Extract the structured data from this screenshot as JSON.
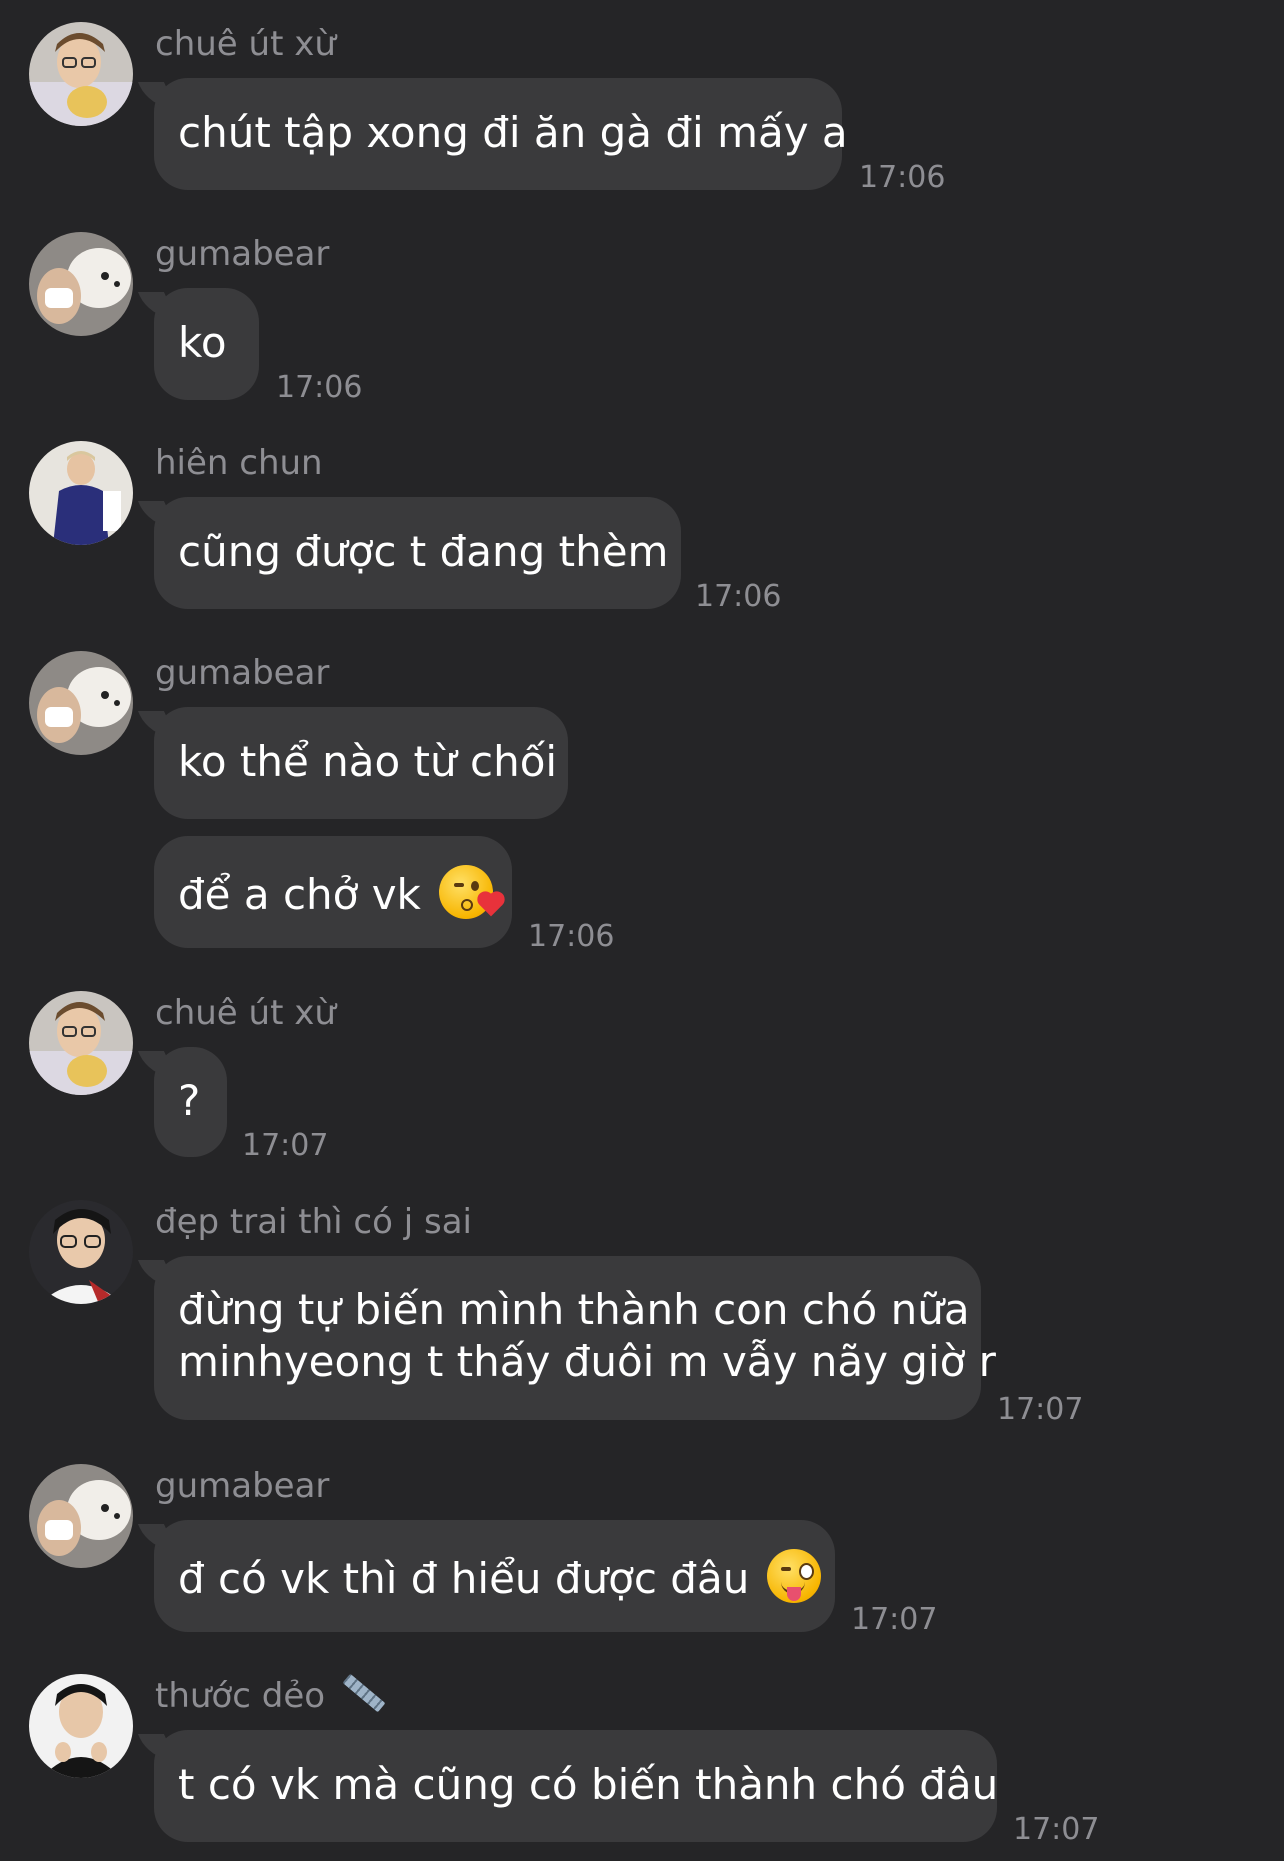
{
  "messages": [
    {
      "sender": "chuê út xừ",
      "lines": [
        "chút tập xong đi ăn gà đi mấy a"
      ],
      "time": "17:06",
      "avatar": "avatar-blonde-glasses"
    },
    {
      "sender": "gumabear",
      "lines": [
        "ko"
      ],
      "time": "17:06",
      "avatar": "avatar-dog-selfie"
    },
    {
      "sender": "hiên chun",
      "lines": [
        "cũng được t đang thèm"
      ],
      "time": "17:06",
      "avatar": "avatar-blue-hoodie"
    },
    {
      "sender": "gumabear",
      "lines": [
        "ko thể nào từ chối"
      ],
      "avatar": "avatar-dog-selfie"
    },
    {
      "lines": [
        "để a chở vk"
      ],
      "emoji": "face-blowing-kiss-icon",
      "time": "17:06"
    },
    {
      "sender": "chuê út xừ",
      "lines": [
        "?"
      ],
      "time": "17:07",
      "avatar": "avatar-blonde-glasses"
    },
    {
      "sender": "đẹp trai thì có j sai",
      "lines": [
        "đừng tự biến mình thành con chó nữa",
        "minhyeong t thấy đuôi m vẫy nãy giờ r"
      ],
      "time": "17:07",
      "avatar": "avatar-glasses-dark"
    },
    {
      "sender": "gumabear",
      "lines": [
        "đ có vk thì đ hiểu được đâu"
      ],
      "emoji": "winking-face-tongue-icon",
      "time": "17:07",
      "avatar": "avatar-dog-selfie"
    },
    {
      "sender": "thước dẻo",
      "sender_icon": "ruler-icon",
      "lines": [
        "t có vk mà cũng có biến thành chó đâu"
      ],
      "time": "17:07",
      "avatar": "avatar-black-shirt"
    }
  ]
}
